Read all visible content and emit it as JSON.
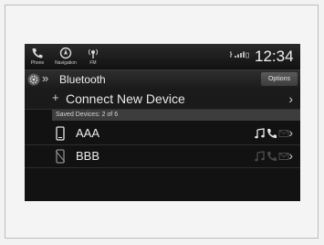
{
  "status_bar": {
    "nav": [
      {
        "label": "Phone",
        "icon": "phone-icon"
      },
      {
        "label": "Navigation",
        "icon": "navigation-icon"
      },
      {
        "label": "FM",
        "icon": "fm-radio-icon"
      }
    ],
    "time": "12:34"
  },
  "header": {
    "title": "Bluetooth",
    "options_label": "Options"
  },
  "connect": {
    "label": "Connect New Device"
  },
  "saved": {
    "header": "Saved Devices: 2 of 6",
    "devices": [
      {
        "name": "AAA",
        "connected": true,
        "icons": [
          "music-icon",
          "phone-handset-icon",
          "message-icon"
        ]
      },
      {
        "name": "BBB",
        "connected": false,
        "icons": [
          "music-icon",
          "phone-handset-icon",
          "message-icon"
        ]
      }
    ]
  },
  "colors": {
    "screen_bg": "#121212",
    "text": "#eeeeee",
    "saved_header_bg": "#3d3d3d",
    "options_bg": "#4a4a4a"
  }
}
